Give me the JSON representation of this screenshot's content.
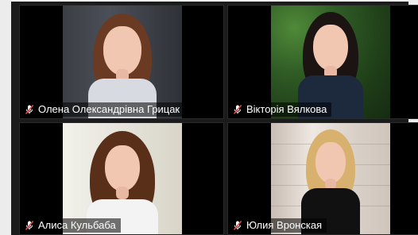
{
  "participants": [
    {
      "name": "Олена Олександрівна Грицак",
      "mic": "mic-muted-icon"
    },
    {
      "name": "Вікторія Вялкова",
      "mic": "mic-muted-icon"
    },
    {
      "name": "Алиса Кульбаба",
      "mic": "mic-muted-icon"
    },
    {
      "name": "Юлия Вронская",
      "mic": "mic-muted-icon"
    }
  ],
  "colors": {
    "tile_bg": "#000000",
    "label_text": "#ffffff",
    "mic_muted": "#e24b4b"
  }
}
